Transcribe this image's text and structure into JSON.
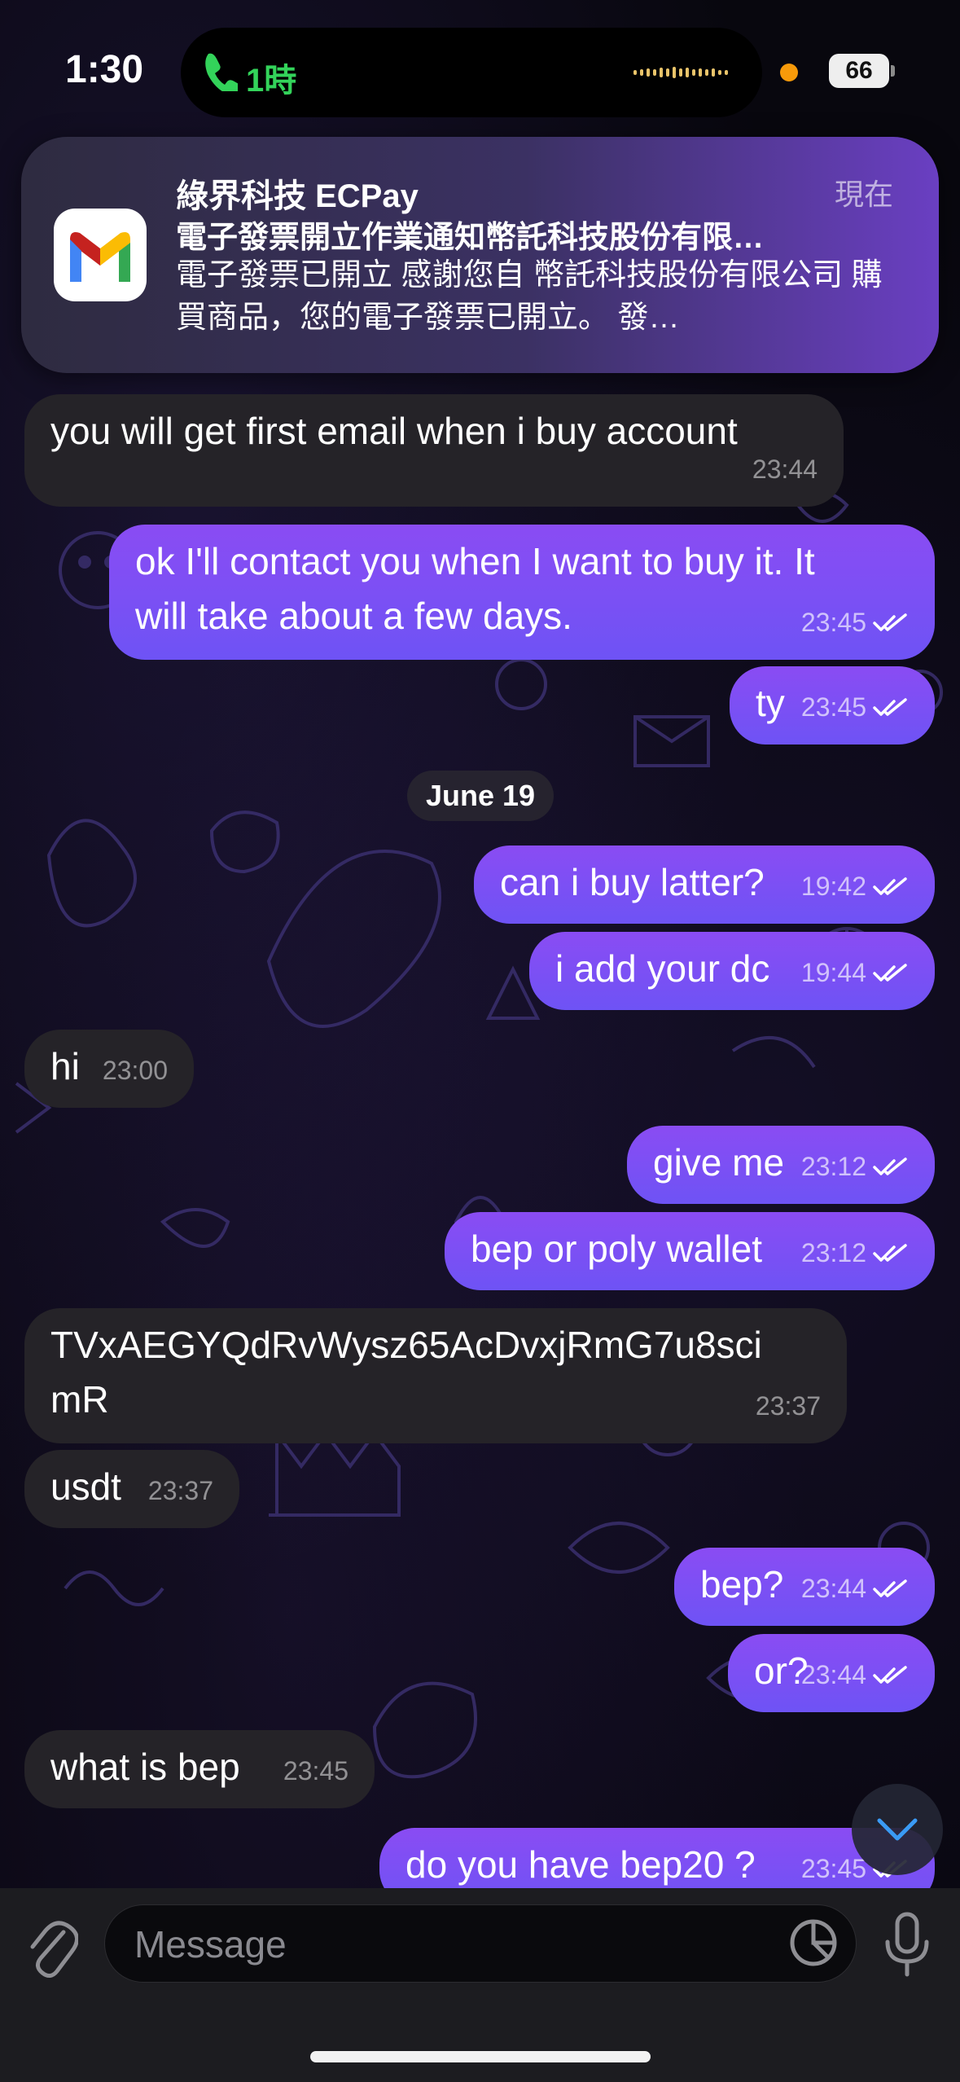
{
  "status_bar": {
    "time": "1:30",
    "call_duration": "1時",
    "battery": "66"
  },
  "notification": {
    "app_icon": "gmail-icon",
    "sender": "綠界科技 ECPay",
    "time": "現在",
    "subject": "電子發票開立作業通知幣託科技股份有限…",
    "body": "電子發票已開立 感謝您自 幣託科技股份有限公司 購買商品，您的電子發票已開立。 發…"
  },
  "conversation": {
    "date_separator": "June 19",
    "messages": [
      {
        "dir": "in",
        "text": "you will get first email when i buy account",
        "time": "23:44"
      },
      {
        "dir": "out",
        "text": "ok I'll contact you when I want to buy it. It\nwill take about a few days.",
        "time": "23:45"
      },
      {
        "dir": "out",
        "text": "ty",
        "time": "23:45"
      },
      {
        "dir": "out",
        "text": "can i buy latter?",
        "time": "19:42"
      },
      {
        "dir": "out",
        "text": "i add your dc",
        "time": "19:44"
      },
      {
        "dir": "in",
        "text": "hi",
        "time": "23:00"
      },
      {
        "dir": "out",
        "text": "give me",
        "time": "23:12"
      },
      {
        "dir": "out",
        "text": "bep or poly wallet",
        "time": "23:12"
      },
      {
        "dir": "in",
        "text": "TVxAEGYQdRvWysz65AcDvxjRmG7u8sci\nmR",
        "time": "23:37"
      },
      {
        "dir": "in",
        "text": "usdt",
        "time": "23:37"
      },
      {
        "dir": "out",
        "text": "bep?",
        "time": "23:44"
      },
      {
        "dir": "out",
        "text": "or?",
        "time": "23:44"
      },
      {
        "dir": "in",
        "text": "what is bep",
        "time": "23:45"
      },
      {
        "dir": "out",
        "text": "do you have bep20 ?",
        "time": "23:45"
      }
    ]
  },
  "composer": {
    "placeholder": "Message",
    "attach_icon": "paperclip-icon",
    "sticker_icon": "sticker-icon",
    "mic_icon": "microphone-icon",
    "scroll_icon": "chevron-down-icon"
  },
  "colors": {
    "outgoing_bubble_top": "#8a4cf3",
    "outgoing_bubble_bottom": "#6e53f5",
    "incoming_bubble": "#252328",
    "call_green": "#33d35a"
  }
}
